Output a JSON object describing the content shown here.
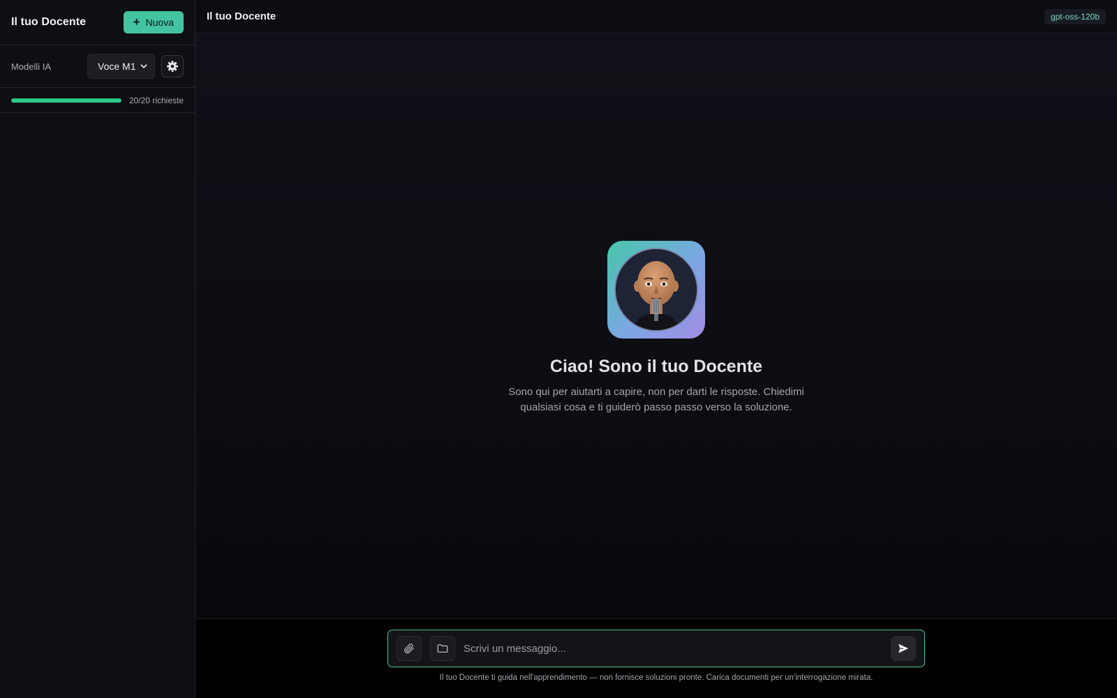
{
  "sidebar": {
    "title": "Il tuo Docente",
    "new_button": {
      "icon": "plus-icon",
      "label": "Nuova"
    },
    "models": {
      "label": "Modelli IA",
      "selected": "Voce M1",
      "settings_icon": "gear-icon"
    },
    "usage": {
      "fraction": 1.0,
      "text": "20/20 richieste"
    }
  },
  "topbar": {
    "title": "Il tuo Docente",
    "model_badge": "gpt-oss-120b"
  },
  "welcome": {
    "avatar_icon": "teacher-avatar-icon",
    "title": "Ciao! Sono il tuo Docente",
    "subtitle": "Sono qui per aiutarti a capire, non per darti le risposte. Chiedimi qualsiasi cosa e ti guiderò passo passo verso la soluzione."
  },
  "composer": {
    "attach_icon": "paperclip-icon",
    "folder_icon": "folder-icon",
    "placeholder": "Scrivi un messaggio...",
    "send_icon": "send-icon"
  },
  "footer_note": "Il tuo Docente ti guida nell'apprendimento — non fornisce soluzioni pronte. Carica documenti per un'interrogazione mirata.",
  "colors": {
    "accent": "#44c3a0",
    "progress": "#2cc98a",
    "badge_text": "#7fd6b9",
    "background": "#0b0c10"
  }
}
